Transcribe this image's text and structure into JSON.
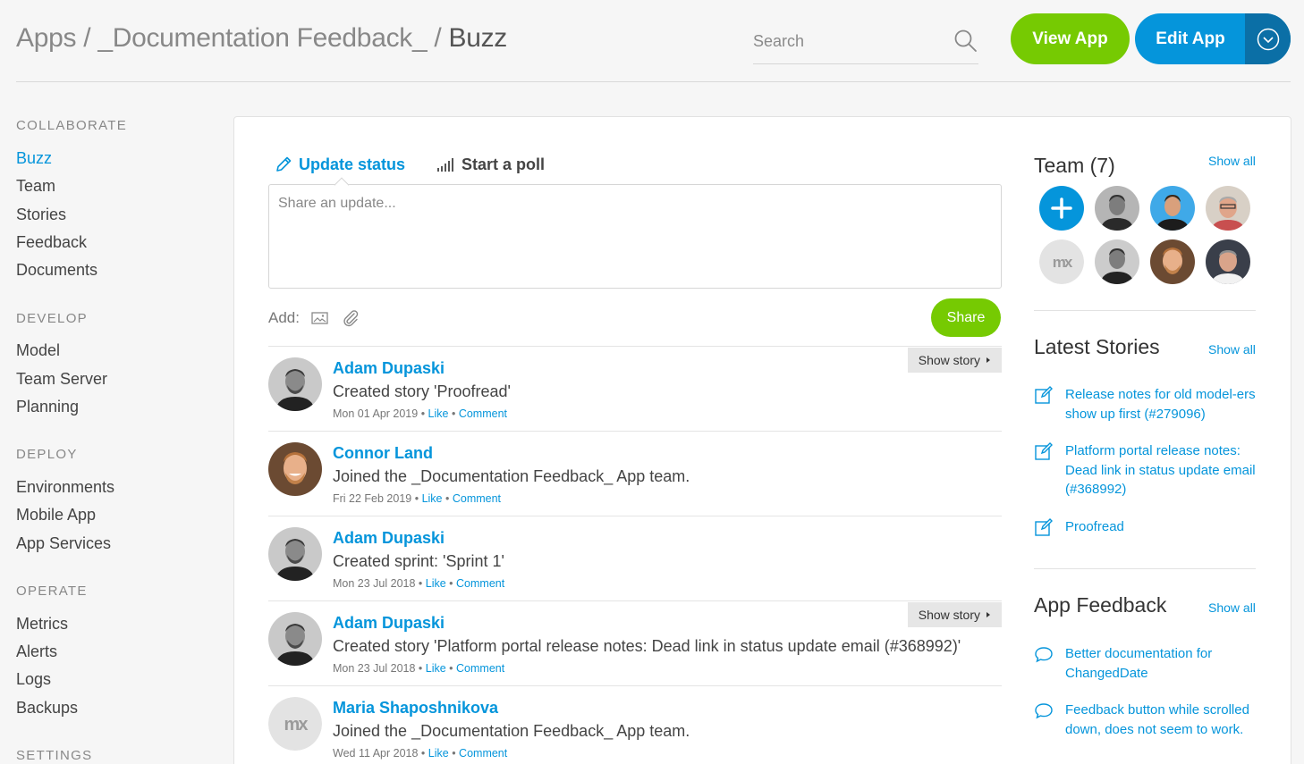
{
  "header": {
    "breadcrumb_root": "Apps",
    "breadcrumb_sep1": "/",
    "breadcrumb_app": "_Documentation Feedback_",
    "breadcrumb_sep2": "/",
    "breadcrumb_current": "Buzz",
    "search_placeholder": "Search",
    "view_app_label": "View App",
    "edit_app_label": "Edit App"
  },
  "sidebar": {
    "sections": [
      {
        "title": "COLLABORATE",
        "items": [
          "Buzz",
          "Team",
          "Stories",
          "Feedback",
          "Documents"
        ]
      },
      {
        "title": "DEVELOP",
        "items": [
          "Model",
          "Team Server",
          "Planning"
        ]
      },
      {
        "title": "DEPLOY",
        "items": [
          "Environments",
          "Mobile App",
          "App Services"
        ]
      },
      {
        "title": "OPERATE",
        "items": [
          "Metrics",
          "Alerts",
          "Logs",
          "Backups"
        ]
      },
      {
        "title": "SETTINGS",
        "items": []
      }
    ],
    "active_item": "Buzz"
  },
  "composer": {
    "tab_update": "Update status",
    "tab_poll": "Start a poll",
    "placeholder": "Share an update...",
    "add_label": "Add:",
    "share_label": "Share"
  },
  "feed": [
    {
      "name": "Adam Dupaski",
      "message": "Created story 'Proofread'",
      "date": "Mon 01 Apr 2019",
      "like": "Like",
      "comment": "Comment",
      "show_story": "Show story",
      "avatar": "photo-gray"
    },
    {
      "name": "Connor Land",
      "message": "Joined the _Documentation Feedback_ App team.",
      "date": "Fri 22 Feb 2019",
      "like": "Like",
      "comment": "Comment",
      "show_story": "",
      "avatar": "photo-color"
    },
    {
      "name": "Adam Dupaski",
      "message": "Created sprint: 'Sprint 1'",
      "date": "Mon 23 Jul 2018",
      "like": "Like",
      "comment": "Comment",
      "show_story": "",
      "avatar": "photo-gray"
    },
    {
      "name": "Adam Dupaski",
      "message": "Created story 'Platform portal release notes: Dead link in status update email (#368992)'",
      "date": "Mon 23 Jul 2018",
      "like": "Like",
      "comment": "Comment",
      "show_story": "Show story",
      "avatar": "photo-gray"
    },
    {
      "name": "Maria Shaposhnikova",
      "message": "Joined the _Documentation Feedback_ App team.",
      "date": "Wed 11 Apr 2018",
      "like": "Like",
      "comment": "Comment",
      "show_story": "",
      "avatar": "mx-logo"
    }
  ],
  "team": {
    "title": "Team (7)",
    "show_all": "Show all"
  },
  "latest_stories": {
    "title": "Latest Stories",
    "show_all": "Show all",
    "items": [
      "Release notes for old model-ers show up first (#279096)",
      "Platform portal release notes: Dead link in status update email (#368992)",
      "Proofread"
    ]
  },
  "app_feedback": {
    "title": "App Feedback",
    "show_all": "Show all",
    "items": [
      "Better documentation for ChangedDate",
      "Feedback button while scrolled down, does not seem to work."
    ]
  },
  "colors": {
    "accent_blue": "#0595db",
    "accent_green": "#76ca02",
    "edit_caret": "#0b6fa6"
  }
}
